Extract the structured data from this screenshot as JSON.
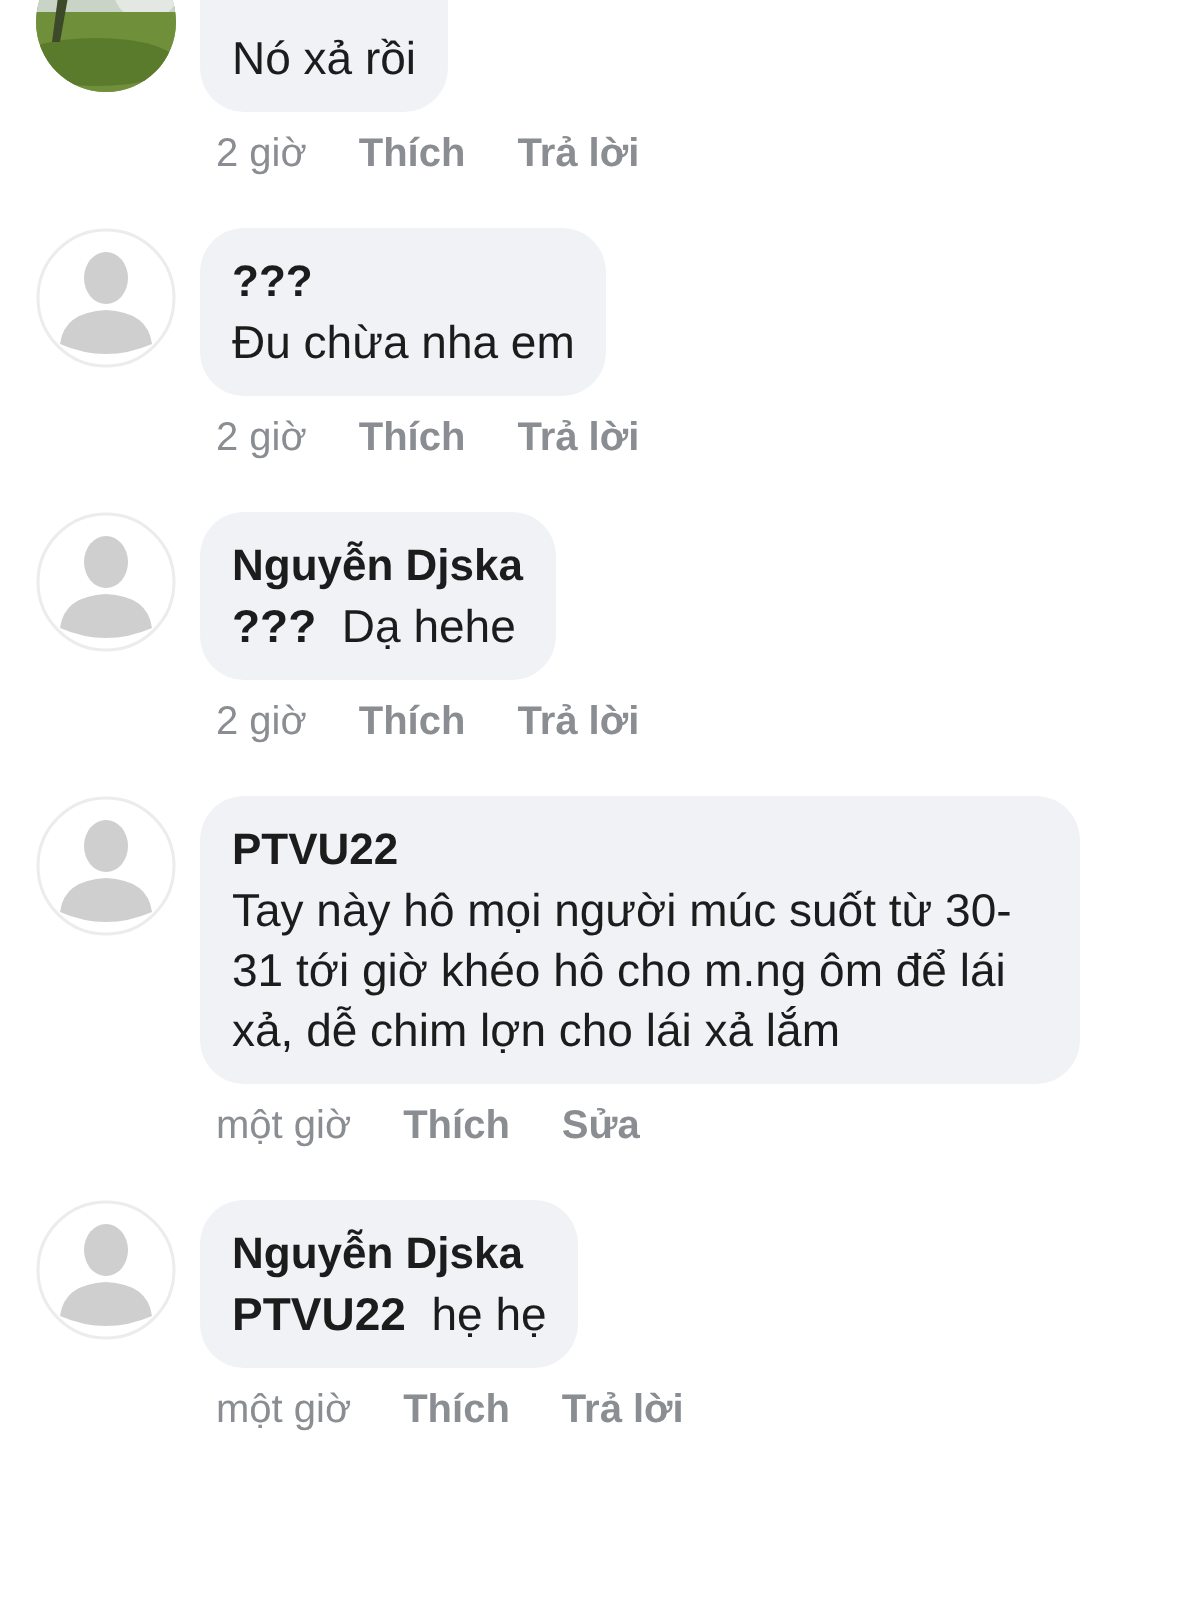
{
  "comments": [
    {
      "text": "Nó xả rồi",
      "time": "2 giờ",
      "like": "Thích",
      "action": "Trả lời"
    },
    {
      "avatar": {
        "kind": "silhouette"
      },
      "author": "???",
      "text": "Đu chừa nha em",
      "time": "2 giờ",
      "like": "Thích",
      "action": "Trả lời"
    },
    {
      "avatar": {
        "kind": "silhouette"
      },
      "author": "Nguyễn Djska",
      "text": "**???**  Dạ hehe",
      "time": "2 giờ",
      "like": "Thích",
      "action": "Trả lời"
    },
    {
      "avatar": {
        "kind": "silhouette"
      },
      "author": "PTVU22",
      "text": "Tay này hô mọi người múc suốt từ 30-31 tới giờ khéo hô cho m.ng ôm để lái xả, dễ chim lợn cho lái xả lắm",
      "time": "một giờ",
      "like": "Thích",
      "action": "Sửa"
    },
    {
      "avatar": {
        "kind": "silhouette"
      },
      "author": "Nguyễn Djska",
      "text": "**PTVU22**  hẹ hẹ",
      "time": "một giờ",
      "like": "Thích",
      "action": "Trả lời"
    }
  ]
}
